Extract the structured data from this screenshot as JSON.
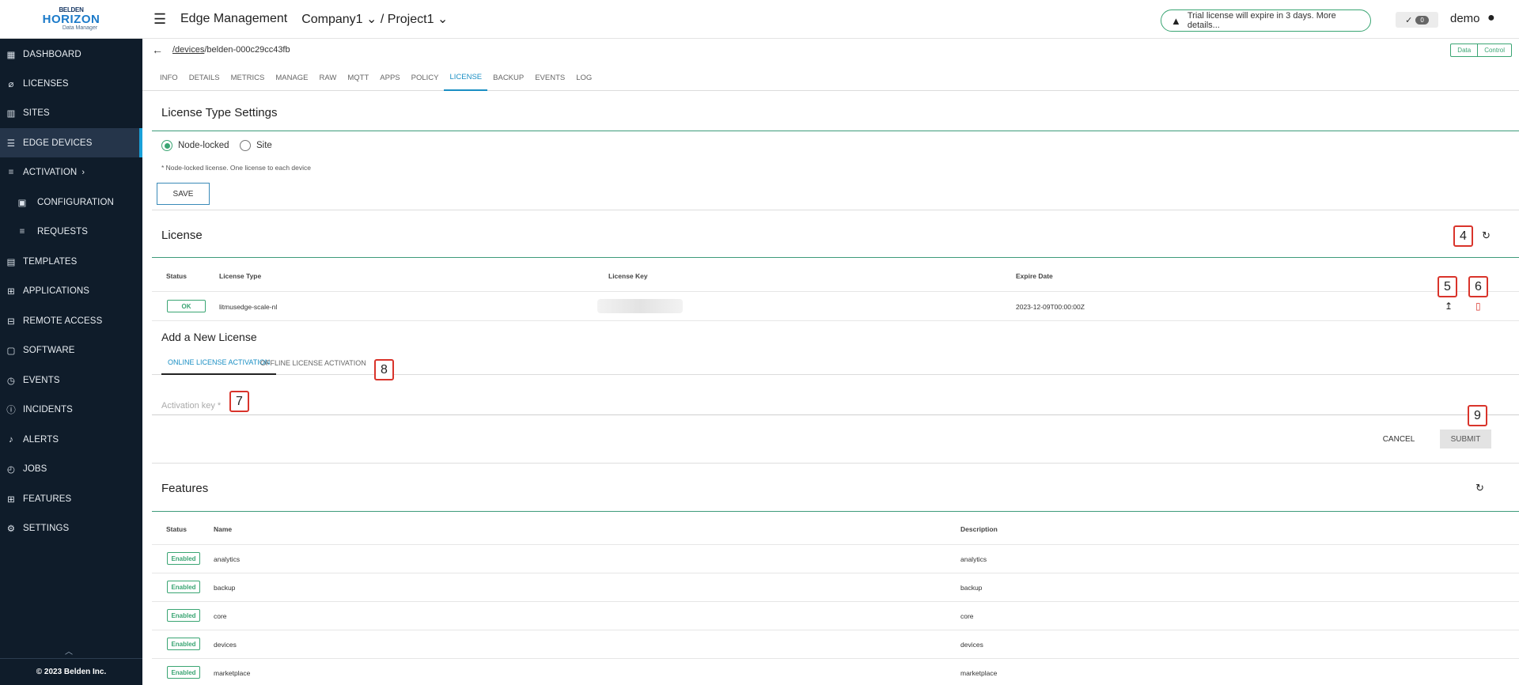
{
  "brand": {
    "line1": "BELDEN",
    "line2": "HORIZON",
    "line3": "Data Manager"
  },
  "sidebar": {
    "items": [
      {
        "label": "DASHBOARD",
        "icon": "dashboard-icon",
        "glyph": "▦"
      },
      {
        "label": "LICENSES",
        "icon": "paperclip-icon",
        "glyph": "⊘"
      },
      {
        "label": "SITES",
        "icon": "building-icon",
        "glyph": "▥"
      },
      {
        "label": "EDGE DEVICES",
        "icon": "list-icon",
        "glyph": "☰"
      },
      {
        "label": "ACTIVATION",
        "icon": "activation-icon",
        "glyph": "≡"
      },
      {
        "label": "CONFIGURATION",
        "icon": "configuration-icon",
        "glyph": "▣"
      },
      {
        "label": "REQUESTS",
        "icon": "requests-icon",
        "glyph": "≡"
      },
      {
        "label": "TEMPLATES",
        "icon": "templates-icon",
        "glyph": "▤"
      },
      {
        "label": "APPLICATIONS",
        "icon": "cart-icon",
        "glyph": "⊞"
      },
      {
        "label": "REMOTE ACCESS",
        "icon": "network-icon",
        "glyph": "⊟"
      },
      {
        "label": "SOFTWARE",
        "icon": "software-icon",
        "glyph": "▢"
      },
      {
        "label": "EVENTS",
        "icon": "clock-icon",
        "glyph": "◷"
      },
      {
        "label": "INCIDENTS",
        "icon": "alert-circle-icon",
        "glyph": "ⓘ"
      },
      {
        "label": "ALERTS",
        "icon": "bell-icon",
        "glyph": "🔔"
      },
      {
        "label": "JOBS",
        "icon": "history-icon",
        "glyph": "◴"
      },
      {
        "label": "FEATURES",
        "icon": "grid-icon",
        "glyph": "⊞"
      },
      {
        "label": "SETTINGS",
        "icon": "gear-icon",
        "glyph": "⚙"
      }
    ],
    "footer": "© 2023 Belden Inc."
  },
  "header": {
    "app_title": "Edge Management",
    "company": "Company1 ⌄ / Project1 ⌄",
    "trial_notice": "Trial license will expire in 3 days. More details...",
    "notif_count": "0",
    "user": "demo"
  },
  "breadcrumb": {
    "link": "/devices",
    "device": "/belden-000c29cc43fb"
  },
  "mode_toggle": {
    "data": "Data",
    "control": "Control"
  },
  "tabs": [
    "INFO",
    "DETAILS",
    "METRICS",
    "MANAGE",
    "RAW",
    "MQTT",
    "APPS",
    "POLICY",
    "LICENSE",
    "BACKUP",
    "EVENTS",
    "LOG"
  ],
  "active_tab": "LICENSE",
  "license_type": {
    "title": "License Type Settings",
    "option_node": "Node-locked",
    "option_site": "Site",
    "selected": "Node-locked",
    "hint": "* Node-locked license. One license to each device",
    "save": "SAVE"
  },
  "license": {
    "title": "License",
    "headers": {
      "status": "Status",
      "type": "License Type",
      "key": "License Key",
      "expire": "Expire Date"
    },
    "row": {
      "status": "OK",
      "type": "litmusedge-scale-nl",
      "expire": "2023-12-09T00:00:00Z"
    }
  },
  "add_license": {
    "title": "Add a New License",
    "tab_online": "ONLINE LICENSE ACTIVATION",
    "tab_offline": "OFFLINE LICENSE ACTIVATION",
    "activation_placeholder": "Activation key *",
    "cancel": "CANCEL",
    "submit": "SUBMIT"
  },
  "callouts": {
    "c4": "4",
    "c5": "5",
    "c6": "6",
    "c7": "7",
    "c8": "8",
    "c9": "9"
  },
  "features": {
    "title": "Features",
    "headers": {
      "status": "Status",
      "name": "Name",
      "description": "Description"
    },
    "rows": [
      {
        "status": "Enabled",
        "name": "analytics",
        "description": "analytics"
      },
      {
        "status": "Enabled",
        "name": "backup",
        "description": "backup"
      },
      {
        "status": "Enabled",
        "name": "core",
        "description": "core"
      },
      {
        "status": "Enabled",
        "name": "devices",
        "description": "devices"
      },
      {
        "status": "Enabled",
        "name": "marketplace",
        "description": "marketplace"
      }
    ]
  },
  "colors": {
    "accent": "#3aa573",
    "link": "#1a8fc4",
    "sidebar": "#0f1c2a",
    "callout": "#d9342b"
  }
}
